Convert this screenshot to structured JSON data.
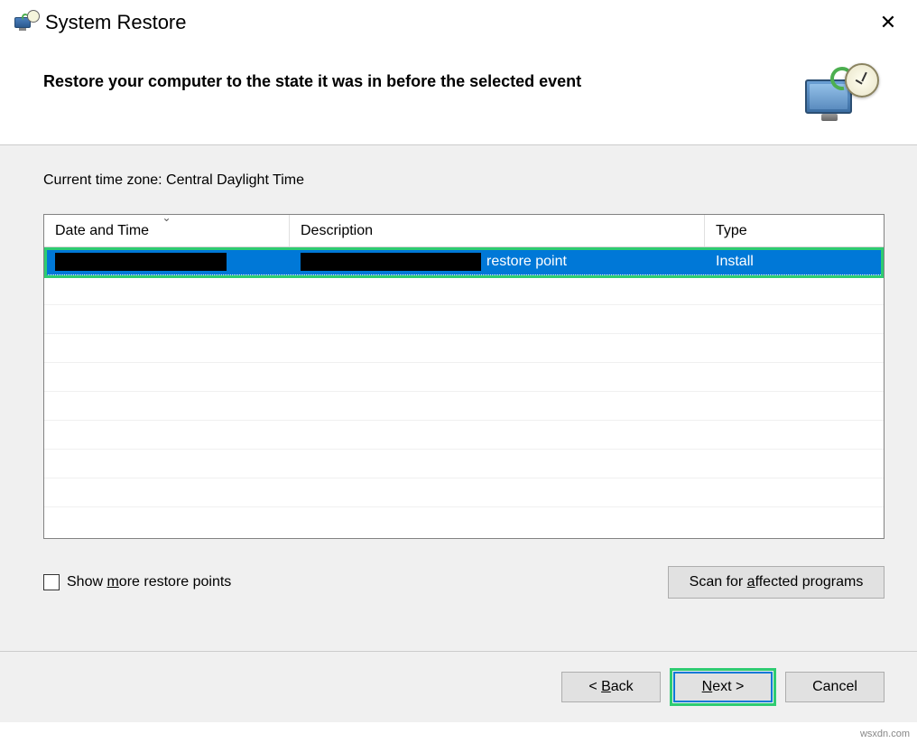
{
  "titlebar": {
    "title": "System Restore"
  },
  "header": {
    "instruction": "Restore your computer to the state it was in before the selected event"
  },
  "body": {
    "timezone_label": "Current time zone: Central Daylight Time",
    "columns": {
      "date": "Date and Time",
      "description": "Description",
      "type": "Type"
    },
    "rows": [
      {
        "description_suffix": "restore point",
        "type": "Install"
      }
    ],
    "show_more_label": "Show more restore points",
    "scan_label": "Scan for affected programs"
  },
  "footer": {
    "back": "< Back",
    "next": "Next >",
    "cancel": "Cancel"
  },
  "watermark": "wsxdn.com"
}
